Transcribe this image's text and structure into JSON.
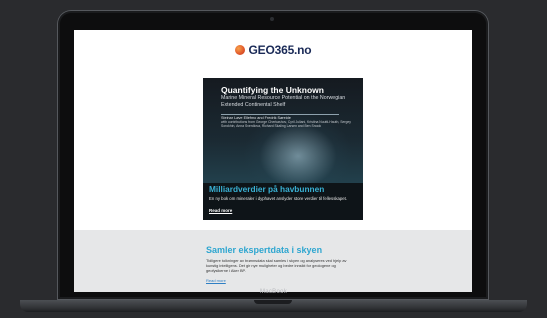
{
  "device": {
    "brand": "MacBook"
  },
  "site": {
    "logo_text": "GEO365",
    "logo_tld": ".no",
    "logo_icon": "globe-icon"
  },
  "feature": {
    "cover_title": "Quantifying the Unknown",
    "cover_subtitle": "Marine Mineral Resource Potential on the Norwegian Extended Continental Shelf",
    "cover_authors_main": "Steinar Løve Ellefmo and Fredrik Søreide",
    "cover_authors_more": "with contributions from George Cherkashov, Cyril Juliani, Kristina Nuutti-Hauth, Sergey Sorokhin, Anna Sverdlova, Richard Skaling Larsen and Ben Snook",
    "headline": "Milliardverdier på havbunnen",
    "excerpt": "En ny bok om mineraler i dyphavet anslyder store verdier til fellesskapet.",
    "read_more": "Read more"
  },
  "second": {
    "headline": "Samler ekspertdata i skyen",
    "excerpt": "Tidligere tolkninger av brønnsdata skal samles i skyen og analyseres ved hjelp av kunstig intelligens. Det gir nye muligheter og bedre innsikt for geologene og geofysikerne i Aker BP.",
    "read_more": "Read more"
  },
  "colors": {
    "accent": "#2ea6d0",
    "brand_navy": "#1a2a57",
    "grey_band": "#e6e7e8"
  }
}
